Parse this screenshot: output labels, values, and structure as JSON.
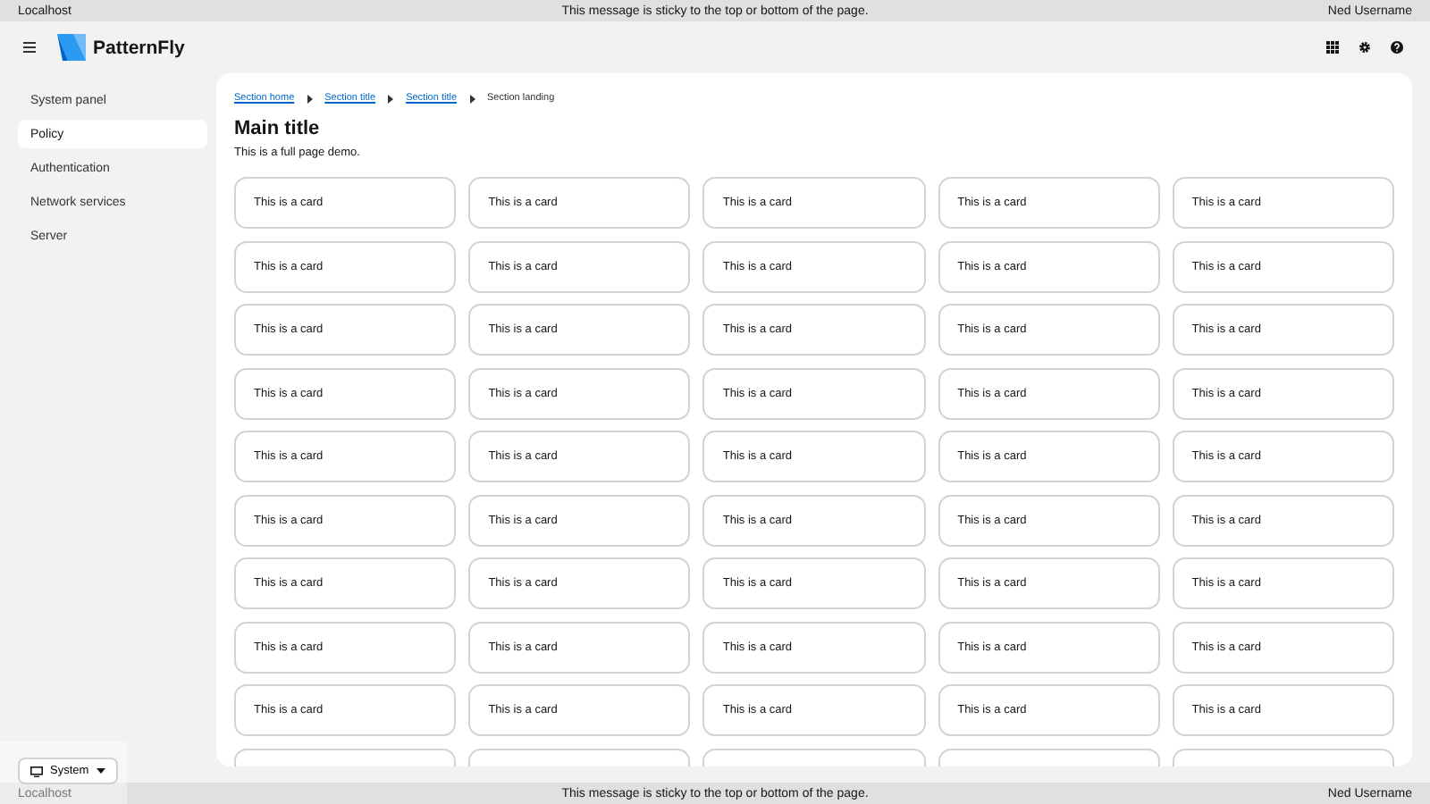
{
  "top_banner": {
    "left": "Localhost",
    "message": "This message is sticky to the top or bottom of the page.",
    "right": "Ned Username"
  },
  "masthead": {
    "brand": "PatternFly"
  },
  "sidebar": {
    "items": [
      {
        "label": "System panel",
        "selected": false
      },
      {
        "label": "Policy",
        "selected": true
      },
      {
        "label": "Authentication",
        "selected": false
      },
      {
        "label": "Network services",
        "selected": false
      },
      {
        "label": "Server",
        "selected": false
      }
    ],
    "theme_button": "System"
  },
  "breadcrumb": [
    {
      "label": "Section home",
      "kind": "link"
    },
    {
      "label": "Section title",
      "kind": "link"
    },
    {
      "label": "Section title",
      "kind": "link"
    },
    {
      "label": "Section landing",
      "kind": "current"
    }
  ],
  "title": "Main title",
  "subtitle": "This is a full page demo.",
  "cards": [
    "This is a card",
    "This is a card",
    "This is a card",
    "This is a card",
    "This is a card",
    "This is a card",
    "This is a card",
    "This is a card",
    "This is a card",
    "This is a card",
    "This is a card",
    "This is a card",
    "This is a card",
    "This is a card",
    "This is a card",
    "This is a card",
    "This is a card",
    "This is a card",
    "This is a card",
    "This is a card",
    "This is a card",
    "This is a card",
    "This is a card",
    "This is a card",
    "This is a card",
    "This is a card",
    "This is a card",
    "This is a card",
    "This is a card",
    "This is a card",
    "This is a card",
    "This is a card",
    "This is a card",
    "This is a card",
    "This is a card",
    "This is a card",
    "This is a card",
    "This is a card",
    "This is a card",
    "This is a card",
    "This is a card",
    "This is a card",
    "This is a card",
    "This is a card",
    "This is a card"
  ],
  "bottom_banner": {
    "left": "Localhost",
    "message": "This message is sticky to the top or bottom of the page.",
    "right": "Ned Username"
  }
}
